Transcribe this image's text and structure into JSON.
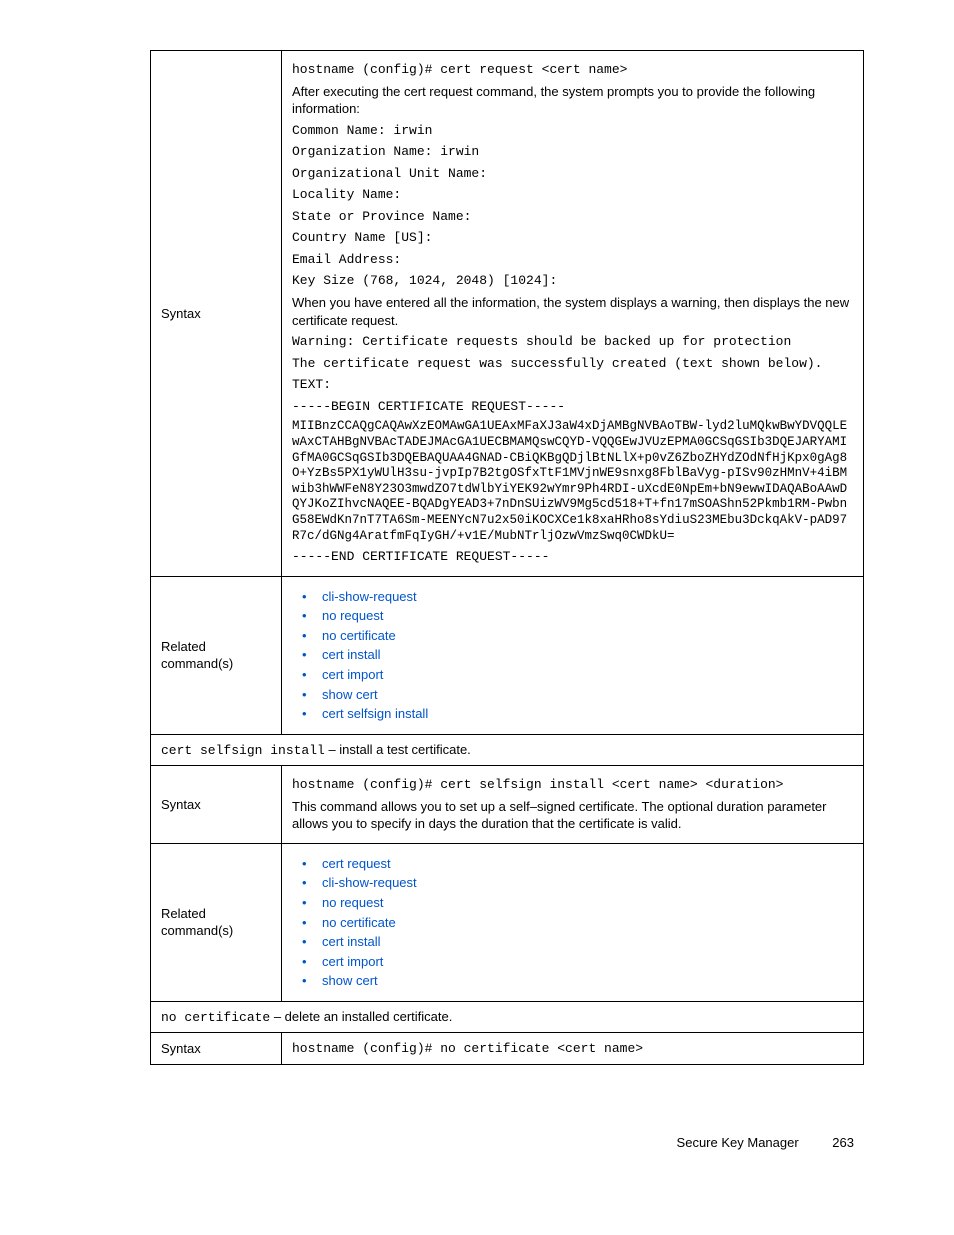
{
  "row1": {
    "label": "Syntax",
    "cmd": "hostname (config)# cert request <cert name>",
    "desc1": "After executing the cert request command, the system prompts you to provide the following information:",
    "p1": "Common Name:  irwin",
    "p2": "Organization Name:  irwin",
    "p3": "Organizational Unit Name:",
    "p4": "Locality Name:",
    "p5": "State or Province Name:",
    "p6": "Country Name [US]:",
    "p7": "Email Address:",
    "p8": "Key Size (768, 1024, 2048) [1024]:",
    "desc2": "When you have entered all the information, the system displays a warning, then displays the new certificate request.",
    "warn": "Warning:  Certificate requests should be backed up for protection",
    "succ": "The certificate request was successfully created (text shown below).",
    "textlbl": "TEXT:",
    "begin": "-----BEGIN CERTIFICATE REQUEST-----",
    "body": "MIIBnzCCAQgCAQAwXzEOMAwGA1UEAxMFaXJ3aW4xDjAMBgNVBAoTBW-lyd2luMQkwBwYDVQQLEwAxCTAHBgNVBAcTADEJMAcGA1UECBMAMQswCQYD-VQQGEwJVUzEPMA0GCSqGSIb3DQEJARYAMIGfMA0GCSqGSIb3DQEBAQUAA4GNAD-CBiQKBgQDjlBtNLlX+p0vZ6ZboZHYdZOdNfHjKpx0gAg8O+YzBs5PX1yWUlH3su-jvpIp7B2tgOSfxTtF1MVjnWE9snxg8FblBaVyg-pISv90zHMnV+4iBMwib3hWWFeN8Y23O3mwdZO7tdWlbYiYEK92wYmr9Ph4RDI-uXcdE0NpEm+bN9ewwIDAQABoAAwDQYJKoZIhvcNAQEE-BQADgYEAD3+7nDnSUizWV9Mg5cd518+T+fn17mSOAShn52Pkmb1RM-PwbnG58EWdKn7nT7TA6Sm-MEENYcN7u2x50iKOCXCe1k8xaHRho8sYdiuS23MEbu3DckqAkV-pAD97R7c/dGNg4AratfmFqIyGH/+v1E/MubNTrljOzwVmzSwq0CWDkU=",
    "end": "-----END CERTIFICATE REQUEST-----"
  },
  "row2": {
    "label": "Related command(s)",
    "items": [
      "cli-show-request",
      "no request",
      "no certificate",
      "cert install",
      "cert import",
      "show cert",
      "cert selfsign install"
    ]
  },
  "row3": {
    "cmd": "cert selfsign install",
    "desc": " – install a test certificate."
  },
  "row4": {
    "label": "Syntax",
    "cmd": "hostname (config)# cert selfsign install <cert name> <duration>",
    "desc": "This command allows you to set up a self–signed certificate.  The optional duration parameter allows you to specify in days the duration that the certificate is valid."
  },
  "row5": {
    "label": "Related command(s)",
    "items": [
      "cert request",
      "cli-show-request",
      "no request",
      "no certificate",
      "cert install",
      "cert import",
      "show cert"
    ]
  },
  "row6": {
    "cmd": "no certificate",
    "desc": " – delete an installed certificate."
  },
  "row7": {
    "label": "Syntax",
    "cmd": "hostname (config)# no certificate <cert name>"
  },
  "footer": {
    "title": "Secure Key Manager",
    "page": "263"
  }
}
